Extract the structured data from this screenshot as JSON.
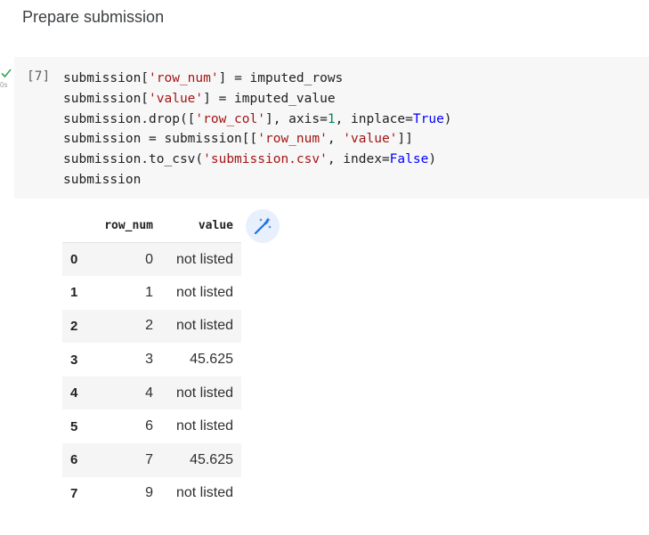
{
  "section": {
    "title": "Prepare submission"
  },
  "cell": {
    "status_icon": "check-icon",
    "exec_time": "0s",
    "exec_count": "[7]",
    "code_lines": [
      "submission['row_num'] = imputed_rows",
      "submission['value'] = imputed_value",
      "submission.drop(['row_col'], axis=1, inplace=True)",
      "submission = submission[['row_num', 'value']]",
      "submission.to_csv('submission.csv', index=False)",
      "submission"
    ],
    "colors": {
      "string": "#a31515",
      "number": "#098658",
      "keyword": "#0000ff"
    }
  },
  "output": {
    "columns": [
      "",
      "row_num",
      "value"
    ],
    "rows": [
      {
        "index": "0",
        "row_num": "0",
        "value": "not listed"
      },
      {
        "index": "1",
        "row_num": "1",
        "value": "not listed"
      },
      {
        "index": "2",
        "row_num": "2",
        "value": "not listed"
      },
      {
        "index": "3",
        "row_num": "3",
        "value": "45.625"
      },
      {
        "index": "4",
        "row_num": "4",
        "value": "not listed"
      },
      {
        "index": "5",
        "row_num": "6",
        "value": "not listed"
      },
      {
        "index": "6",
        "row_num": "7",
        "value": "45.625"
      },
      {
        "index": "7",
        "row_num": "9",
        "value": "not listed"
      }
    ],
    "magic_button_icon": "magic-wand-icon"
  }
}
